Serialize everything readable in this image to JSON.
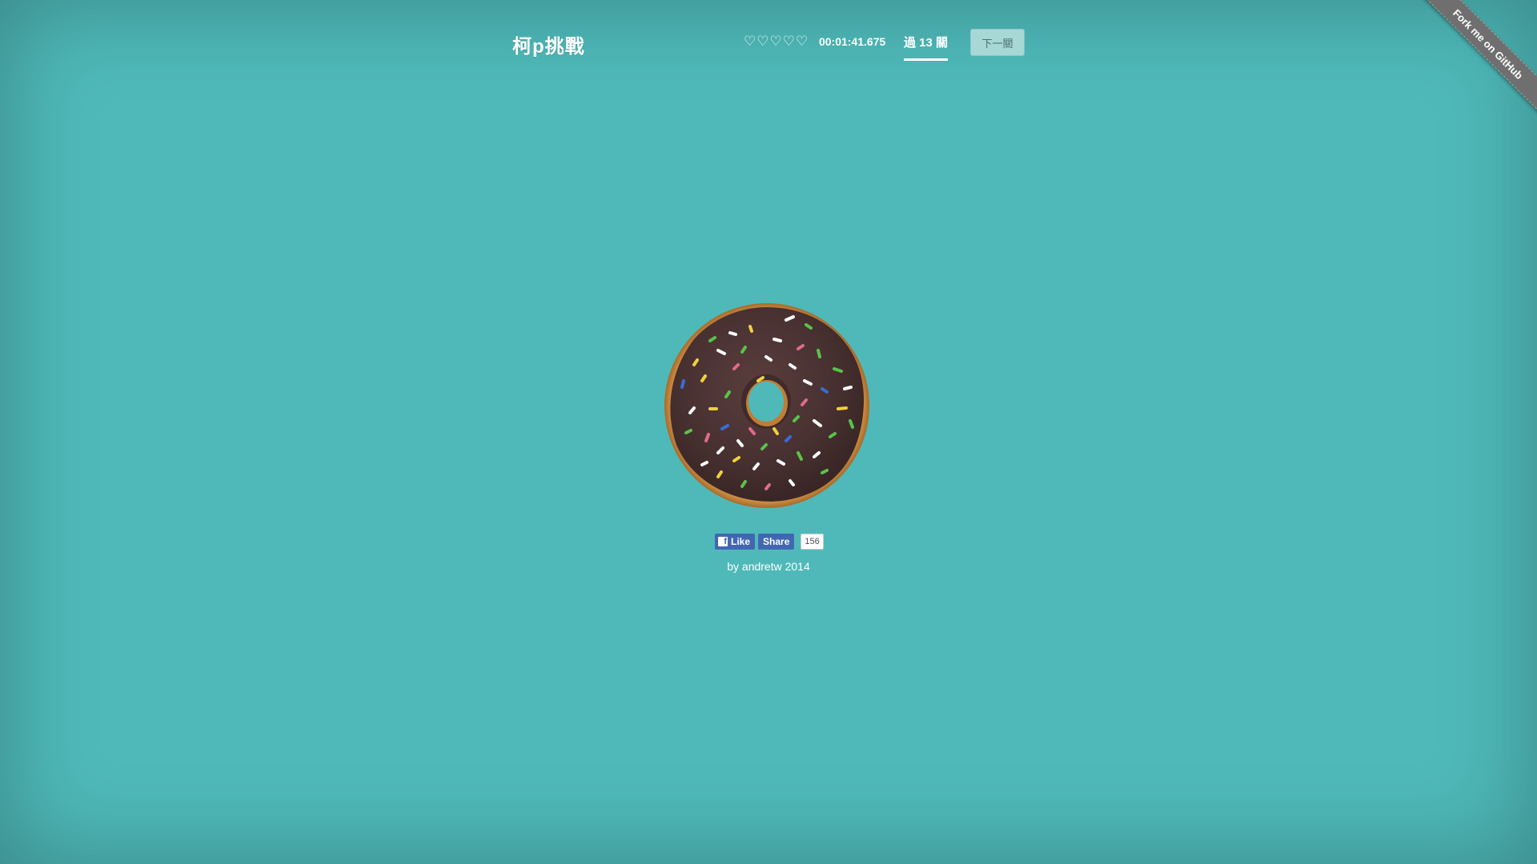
{
  "header": {
    "title": "柯p挑戰",
    "lives": [
      "♡",
      "♡",
      "♡",
      "♡",
      "♡"
    ],
    "timer": "00:01:41.675",
    "level_label": "過 13 關",
    "next_button": "下一關"
  },
  "ribbon": {
    "label": "Fork me on GitHub"
  },
  "social": {
    "like_label": "Like",
    "share_label": "Share",
    "count": "156"
  },
  "footer": {
    "credit": "by andretw 2014"
  },
  "colors": {
    "background": "#4fb9b9",
    "facebook": "#4267b2",
    "icing": "#4a3232",
    "dough": "#c88a3e"
  },
  "icons": {
    "life": "heart-outline-icon",
    "facebook": "facebook-icon"
  }
}
